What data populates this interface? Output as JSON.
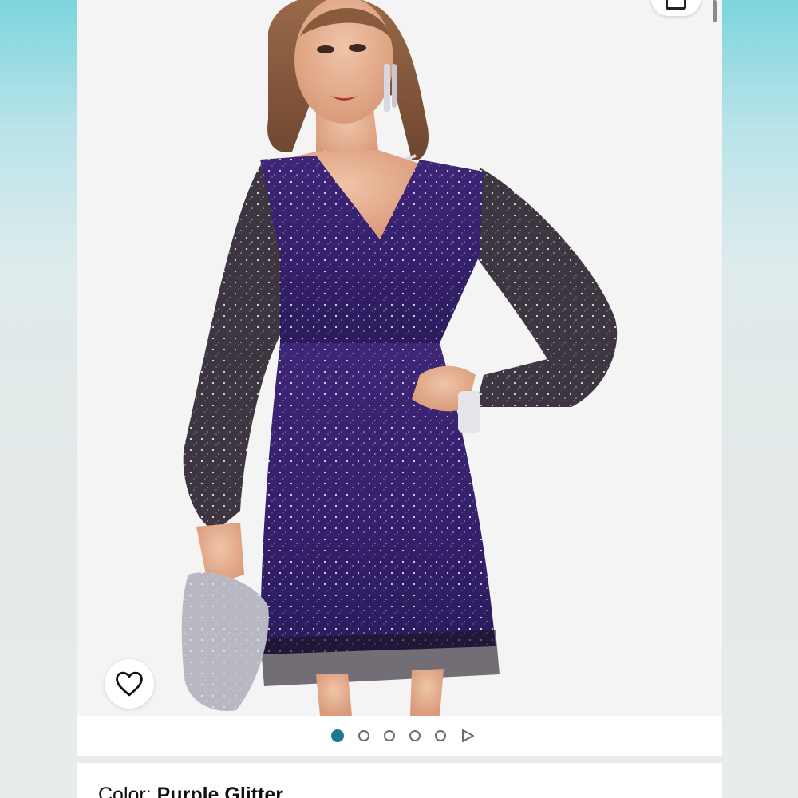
{
  "product": {
    "image_alt": "Purple glitter wrap mini dress with sheer sparkle balloon sleeves",
    "color_label": "Color:",
    "color_value": "Purple Glitter"
  },
  "carousel": {
    "total_images": 5,
    "active_index": 0,
    "has_video": true
  },
  "icons": {
    "wishlist": "heart-outline-icon",
    "share": "share-icon",
    "next": "play-triangle-icon"
  },
  "colors": {
    "accent": "#1b7a8c",
    "dress": "#3a2470",
    "background": "#f4f4f4"
  }
}
